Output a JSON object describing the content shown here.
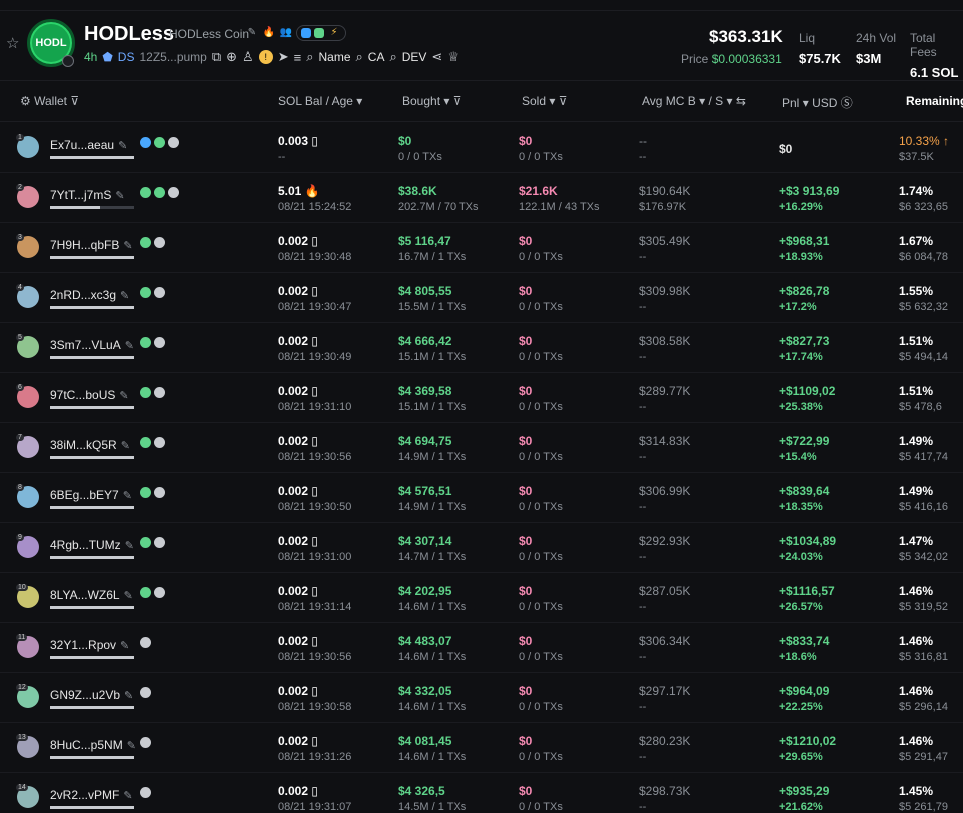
{
  "header": {
    "token_name": "HODLess",
    "token_full_name": "HODLess Coin",
    "logo_text": "HODL",
    "age": "4h",
    "ds_label": "DS",
    "contract_short": "12Z5...pump",
    "search_name": "Name",
    "search_ca": "CA",
    "search_dev": "DEV",
    "market_cap": "$363.31K",
    "price_label": "Price",
    "price_value": "$0.00036331",
    "liq_label": "Liq",
    "liq_value": "$75.7K",
    "vol_label": "24h Vol",
    "vol_value": "$3M",
    "fees_label": "Total Fees",
    "fees_value": "6.1 SOL"
  },
  "columns": {
    "wallet": "Wallet",
    "solbal": "SOL Bal",
    "age": "/ Age",
    "bought": "Bought",
    "sold": "Sold",
    "avg": "Avg MC B",
    "avg_s": "/ S",
    "pnl": "Pnl",
    "usd": "USD",
    "remaining": "Remaining"
  },
  "colors": {
    "green": "#5fd38a",
    "pink": "#f58ab2",
    "orange": "#f5a24a"
  },
  "rows": [
    {
      "rank": "1",
      "wallet": "Ex7u...aeau",
      "sol": "0.003 ▯",
      "age": "--",
      "bought": "$0",
      "btx": "0 / 0 TXs",
      "sold": "$0",
      "stx": "0 / 0 TXs",
      "avg_b": "--",
      "avg_s": "--",
      "pnl": "$0",
      "pnl_pct": "",
      "rem_pct": "10.33% ↑",
      "rem_usd": "$37.5K",
      "avatar": "#7fb3c9"
    },
    {
      "rank": "2",
      "wallet": "7YtT...j7mS",
      "sol": "5.01 🔥",
      "age": "08/21 15:24:52",
      "bought": "$38.6K",
      "btx": "202.7M / 70 TXs",
      "sold": "$21.6K",
      "stx": "122.1M / 43 TXs",
      "avg_b": "$190.64K",
      "avg_s": "$176.97K",
      "pnl": "+$3 913,69",
      "pnl_pct": "+16.29%",
      "rem_pct": "1.74%",
      "rem_usd": "$6 323,65",
      "avatar": "#d98a9b"
    },
    {
      "rank": "3",
      "wallet": "7H9H...qbFB",
      "sol": "0.002 ▯",
      "age": "08/21 19:30:48",
      "bought": "$5 116,47",
      "btx": "16.7M / 1 TXs",
      "sold": "$0",
      "stx": "0 / 0 TXs",
      "avg_b": "$305.49K",
      "avg_s": "--",
      "pnl": "+$968,31",
      "pnl_pct": "+18.93%",
      "rem_pct": "1.67%",
      "rem_usd": "$6 084,78",
      "avatar": "#c9955f"
    },
    {
      "rank": "4",
      "wallet": "2nRD...xc3g",
      "sol": "0.002 ▯",
      "age": "08/21 19:30:47",
      "bought": "$4 805,55",
      "btx": "15.5M / 1 TXs",
      "sold": "$0",
      "stx": "0 / 0 TXs",
      "avg_b": "$309.98K",
      "avg_s": "--",
      "pnl": "+$826,78",
      "pnl_pct": "+17.2%",
      "rem_pct": "1.55%",
      "rem_usd": "$5 632,32",
      "avatar": "#8fb7cf"
    },
    {
      "rank": "5",
      "wallet": "3Sm7...VLuA",
      "sol": "0.002 ▯",
      "age": "08/21 19:30:49",
      "bought": "$4 666,42",
      "btx": "15.1M / 1 TXs",
      "sold": "$0",
      "stx": "0 / 0 TXs",
      "avg_b": "$308.58K",
      "avg_s": "--",
      "pnl": "+$827,73",
      "pnl_pct": "+17.74%",
      "rem_pct": "1.51%",
      "rem_usd": "$5 494,14",
      "avatar": "#8fc48f"
    },
    {
      "rank": "6",
      "wallet": "97tC...boUS",
      "sol": "0.002 ▯",
      "age": "08/21 19:31:10",
      "bought": "$4 369,58",
      "btx": "15.1M / 1 TXs",
      "sold": "$0",
      "stx": "0 / 0 TXs",
      "avg_b": "$289.77K",
      "avg_s": "--",
      "pnl": "+$1109,02",
      "pnl_pct": "+25.38%",
      "rem_pct": "1.51%",
      "rem_usd": "$5 478,6",
      "avatar": "#d97a8a"
    },
    {
      "rank": "7",
      "wallet": "38iM...kQ5R",
      "sol": "0.002 ▯",
      "age": "08/21 19:30:56",
      "bought": "$4 694,75",
      "btx": "14.9M / 1 TXs",
      "sold": "$0",
      "stx": "0 / 0 TXs",
      "avg_b": "$314.83K",
      "avg_s": "--",
      "pnl": "+$722,99",
      "pnl_pct": "+15.4%",
      "rem_pct": "1.49%",
      "rem_usd": "$5 417,74",
      "avatar": "#b7a7c9"
    },
    {
      "rank": "8",
      "wallet": "6BEg...bEY7",
      "sol": "0.002 ▯",
      "age": "08/21 19:30:50",
      "bought": "$4 576,51",
      "btx": "14.9M / 1 TXs",
      "sold": "$0",
      "stx": "0 / 0 TXs",
      "avg_b": "$306.99K",
      "avg_s": "--",
      "pnl": "+$839,64",
      "pnl_pct": "+18.35%",
      "rem_pct": "1.49%",
      "rem_usd": "$5 416,16",
      "avatar": "#7fb7d9"
    },
    {
      "rank": "9",
      "wallet": "4Rgb...TUMz",
      "sol": "0.002 ▯",
      "age": "08/21 19:31:00",
      "bought": "$4 307,14",
      "btx": "14.7M / 1 TXs",
      "sold": "$0",
      "stx": "0 / 0 TXs",
      "avg_b": "$292.93K",
      "avg_s": "--",
      "pnl": "+$1034,89",
      "pnl_pct": "+24.03%",
      "rem_pct": "1.47%",
      "rem_usd": "$5 342,02",
      "avatar": "#a78fc9"
    },
    {
      "rank": "10",
      "wallet": "8LYA...WZ6L",
      "sol": "0.002 ▯",
      "age": "08/21 19:31:14",
      "bought": "$4 202,95",
      "btx": "14.6M / 1 TXs",
      "sold": "$0",
      "stx": "0 / 0 TXs",
      "avg_b": "$287.05K",
      "avg_s": "--",
      "pnl": "+$1116,57",
      "pnl_pct": "+26.57%",
      "rem_pct": "1.46%",
      "rem_usd": "$5 319,52",
      "avatar": "#c9c46f"
    },
    {
      "rank": "11",
      "wallet": "32Y1...Rpov",
      "sol": "0.002 ▯",
      "age": "08/21 19:30:56",
      "bought": "$4 483,07",
      "btx": "14.6M / 1 TXs",
      "sold": "$0",
      "stx": "0 / 0 TXs",
      "avg_b": "$306.34K",
      "avg_s": "--",
      "pnl": "+$833,74",
      "pnl_pct": "+18.6%",
      "rem_pct": "1.46%",
      "rem_usd": "$5 316,81",
      "avatar": "#b78fb7"
    },
    {
      "rank": "12",
      "wallet": "GN9Z...u2Vb",
      "sol": "0.002 ▯",
      "age": "08/21 19:30:58",
      "bought": "$4 332,05",
      "btx": "14.6M / 1 TXs",
      "sold": "$0",
      "stx": "0 / 0 TXs",
      "avg_b": "$297.17K",
      "avg_s": "--",
      "pnl": "+$964,09",
      "pnl_pct": "+22.25%",
      "rem_pct": "1.46%",
      "rem_usd": "$5 296,14",
      "avatar": "#7fc9a7"
    },
    {
      "rank": "13",
      "wallet": "8HuC...p5NM",
      "sol": "0.002 ▯",
      "age": "08/21 19:31:26",
      "bought": "$4 081,45",
      "btx": "14.6M / 1 TXs",
      "sold": "$0",
      "stx": "0 / 0 TXs",
      "avg_b": "$280.23K",
      "avg_s": "--",
      "pnl": "+$1210,02",
      "pnl_pct": "+29.65%",
      "rem_pct": "1.46%",
      "rem_usd": "$5 291,47",
      "avatar": "#9f9fb7"
    },
    {
      "rank": "14",
      "wallet": "2vR2...vPMF",
      "sol": "0.002 ▯",
      "age": "08/21 19:31:07",
      "bought": "$4 326,5",
      "btx": "14.5M / 1 TXs",
      "sold": "$0",
      "stx": "0 / 0 TXs",
      "avg_b": "$298.73K",
      "avg_s": "--",
      "pnl": "+$935,29",
      "pnl_pct": "+21.62%",
      "rem_pct": "1.45%",
      "rem_usd": "$5 261,79",
      "avatar": "#8fb7b7"
    }
  ]
}
